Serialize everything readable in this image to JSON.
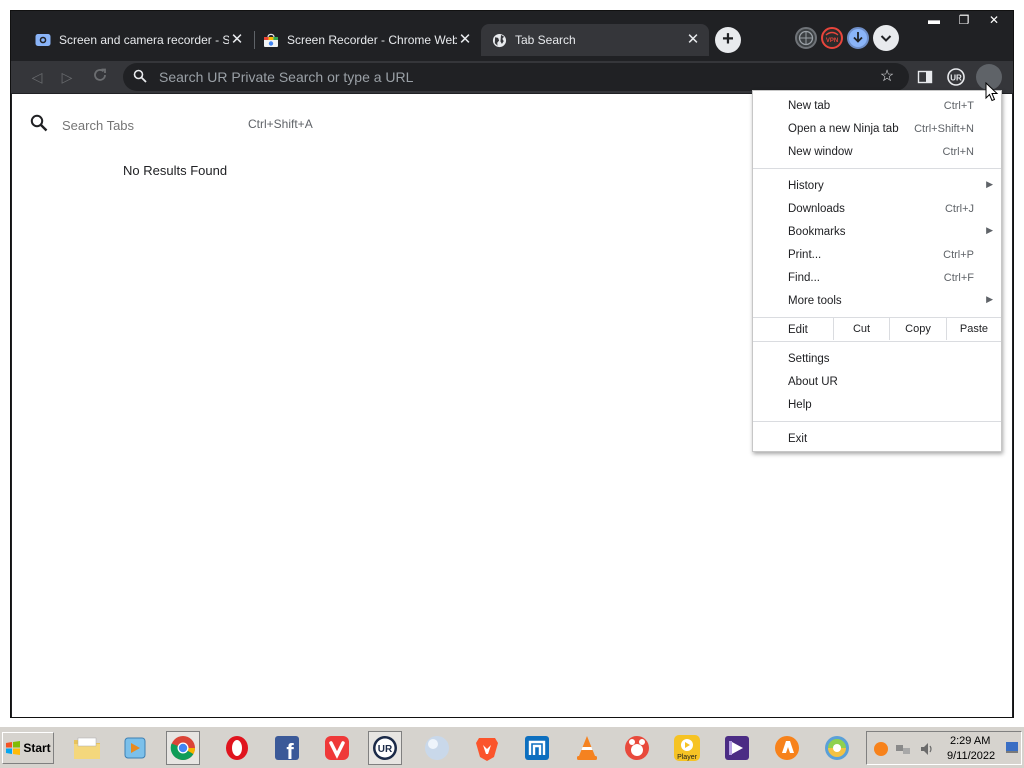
{
  "tabs": [
    {
      "title": "Screen and camera recorder - Scr",
      "active": false
    },
    {
      "title": "Screen Recorder - Chrome Web S",
      "active": false
    },
    {
      "title": "Tab Search",
      "active": true
    }
  ],
  "omnibox": {
    "placeholder": "Search UR Private Search or type a URL"
  },
  "tab_search": {
    "placeholder": "Search Tabs",
    "shortcut": "Ctrl+Shift+A",
    "empty_message": "No Results Found"
  },
  "menu": {
    "new_tab": {
      "label": "New tab",
      "shortcut": "Ctrl+T"
    },
    "ninja_tab": {
      "label": "Open a new Ninja tab",
      "shortcut": "Ctrl+Shift+N"
    },
    "new_window": {
      "label": "New window",
      "shortcut": "Ctrl+N"
    },
    "history": {
      "label": "History"
    },
    "downloads": {
      "label": "Downloads",
      "shortcut": "Ctrl+J"
    },
    "bookmarks": {
      "label": "Bookmarks"
    },
    "print": {
      "label": "Print...",
      "shortcut": "Ctrl+P"
    },
    "find": {
      "label": "Find...",
      "shortcut": "Ctrl+F"
    },
    "more_tools": {
      "label": "More tools"
    },
    "edit": {
      "label": "Edit",
      "cut": "Cut",
      "copy": "Copy",
      "paste": "Paste"
    },
    "settings": {
      "label": "Settings"
    },
    "about": {
      "label": "About UR"
    },
    "help": {
      "label": "Help"
    },
    "exit": {
      "label": "Exit"
    }
  },
  "taskbar": {
    "start_label": "Start",
    "apps": [
      "file-explorer-icon",
      "media-player-icon",
      "chrome-icon",
      "opera-icon",
      "facebook-icon",
      "vivaldi-icon",
      "ur-browser-icon",
      "sphere-icon",
      "brave-icon",
      "maxthon-icon",
      "vlc-icon",
      "gom-icon",
      "player-icon",
      "video-editor-icon",
      "avast-icon",
      "slimjet-icon"
    ],
    "player_label": "Player",
    "clock_time": "2:29 AM",
    "clock_date": "9/11/2022"
  },
  "colors": {
    "tab_strip": "#202124",
    "active_tab": "#35363a",
    "menu_bg": "#ffffff",
    "taskbar": "#d6d3ce"
  }
}
